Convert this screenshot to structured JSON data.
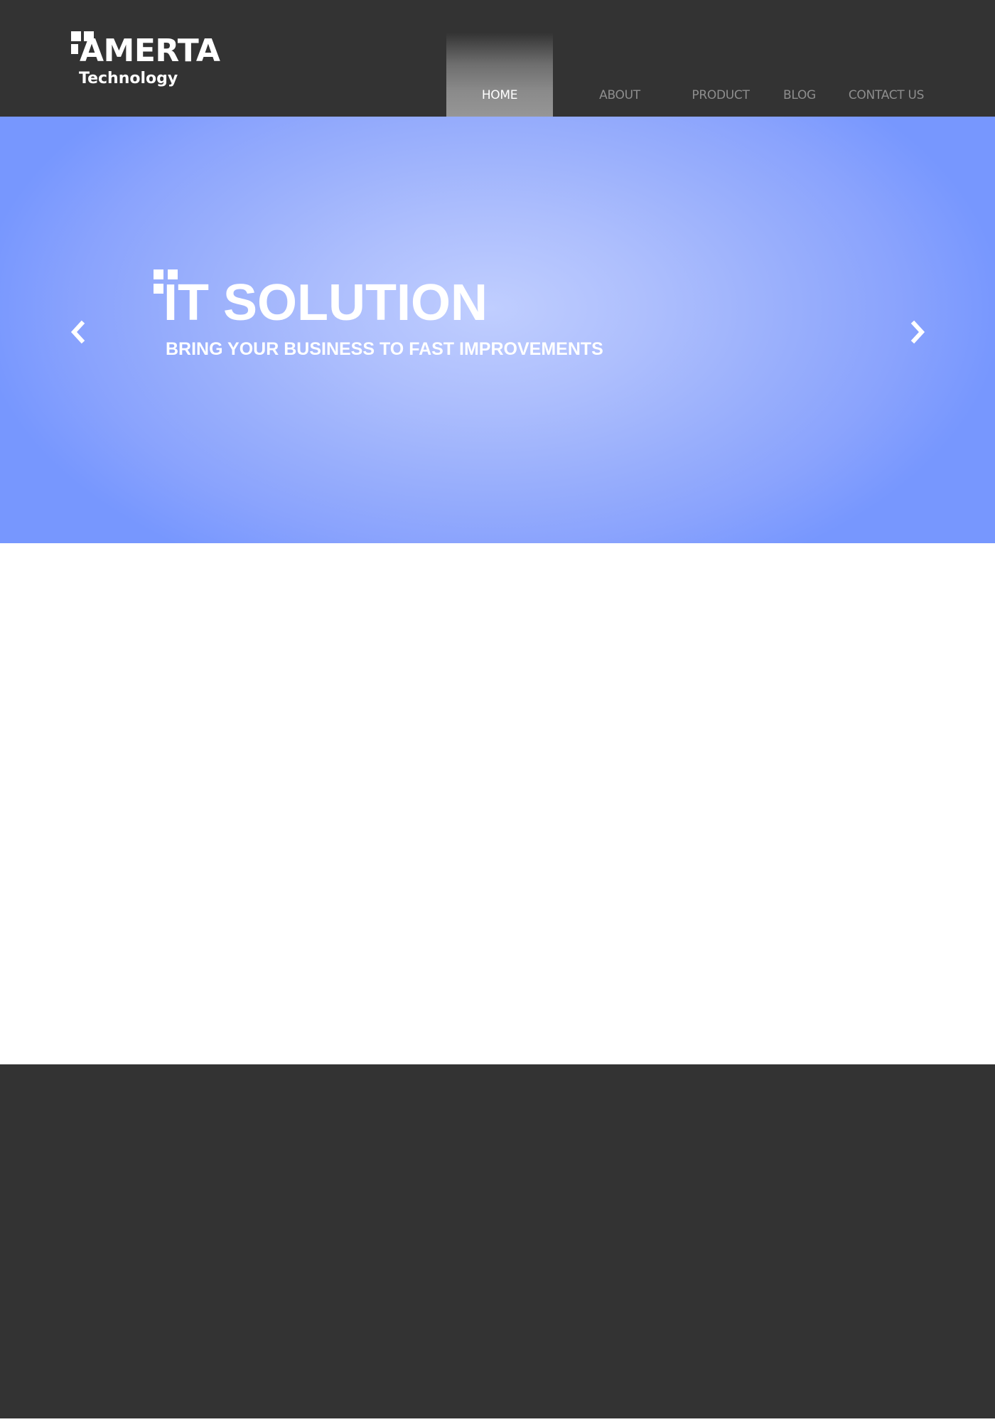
{
  "header": {
    "logo": {
      "name": "AMERTA",
      "subtitle": "Technology"
    },
    "nav": [
      {
        "label": "HOME",
        "active": true
      },
      {
        "label": "ABOUT",
        "active": false
      },
      {
        "label": "PRODUCT",
        "active": false
      },
      {
        "label": "BLOG",
        "active": false
      },
      {
        "label": "CONTACT US",
        "active": false
      }
    ]
  },
  "hero": {
    "title": "IT SOLUTION",
    "subtitle": "BRING YOUR BUSINESS TO FAST IMPROVEMENTS",
    "prev_icon": "chevron-left-icon",
    "next_icon": "chevron-right-icon"
  },
  "colors": {
    "header_bg": "#333333",
    "hero_bg": "#7797fe",
    "hero_center": "#c0ceff",
    "nav_text": "#8e8e8e",
    "nav_active_text": "#ffffff",
    "footer_bg": "#333333"
  }
}
